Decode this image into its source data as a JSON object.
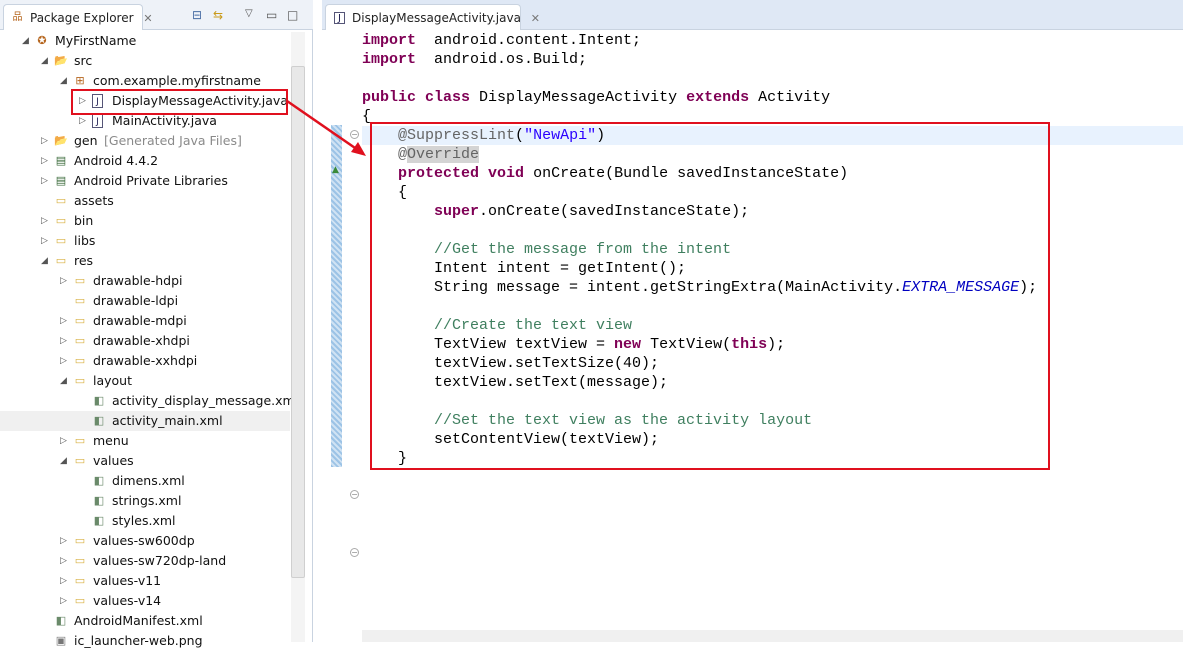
{
  "package_explorer": {
    "title": "Package Explorer",
    "icons": [
      "collapse-all-icon",
      "link-with-editor-icon",
      "view-menu-icon",
      "minimize-icon",
      "maximize-icon"
    ],
    "tree": [
      {
        "label": "MyFirstName",
        "level": 0,
        "state": "open",
        "icon": "project-icon"
      },
      {
        "label": "src",
        "level": 1,
        "state": "open",
        "icon": "source-folder-icon"
      },
      {
        "label": "com.example.myfirstname",
        "level": 2,
        "state": "open",
        "icon": "package-icon"
      },
      {
        "label": "DisplayMessageActivity.java",
        "level": 3,
        "state": "closed",
        "icon": "java-file-icon",
        "highlighted": true
      },
      {
        "label": "MainActivity.java",
        "level": 3,
        "state": "closed",
        "icon": "java-file-icon"
      },
      {
        "label": "gen",
        "suffix": "[Generated Java Files]",
        "level": 1,
        "state": "closed",
        "icon": "source-folder-icon"
      },
      {
        "label": "Android 4.4.2",
        "level": 1,
        "state": "closed",
        "icon": "library-icon"
      },
      {
        "label": "Android Private Libraries",
        "level": 1,
        "state": "closed",
        "icon": "library-icon"
      },
      {
        "label": "assets",
        "level": 1,
        "state": "none",
        "icon": "folder-icon"
      },
      {
        "label": "bin",
        "level": 1,
        "state": "closed",
        "icon": "folder-icon"
      },
      {
        "label": "libs",
        "level": 1,
        "state": "closed",
        "icon": "folder-icon"
      },
      {
        "label": "res",
        "level": 1,
        "state": "open",
        "icon": "folder-icon"
      },
      {
        "label": "drawable-hdpi",
        "level": 2,
        "state": "closed",
        "icon": "folder-icon"
      },
      {
        "label": "drawable-ldpi",
        "level": 2,
        "state": "none",
        "icon": "folder-icon"
      },
      {
        "label": "drawable-mdpi",
        "level": 2,
        "state": "closed",
        "icon": "folder-icon"
      },
      {
        "label": "drawable-xhdpi",
        "level": 2,
        "state": "closed",
        "icon": "folder-icon"
      },
      {
        "label": "drawable-xxhdpi",
        "level": 2,
        "state": "closed",
        "icon": "folder-icon"
      },
      {
        "label": "layout",
        "level": 2,
        "state": "open",
        "icon": "folder-icon"
      },
      {
        "label": "activity_display_message.xml",
        "level": 3,
        "state": "none",
        "icon": "xml-file-icon"
      },
      {
        "label": "activity_main.xml",
        "level": 3,
        "state": "none",
        "icon": "xml-file-icon",
        "selected": true
      },
      {
        "label": "menu",
        "level": 2,
        "state": "closed",
        "icon": "folder-icon"
      },
      {
        "label": "values",
        "level": 2,
        "state": "open",
        "icon": "folder-icon"
      },
      {
        "label": "dimens.xml",
        "level": 3,
        "state": "none",
        "icon": "xml-file-icon"
      },
      {
        "label": "strings.xml",
        "level": 3,
        "state": "none",
        "icon": "xml-file-icon"
      },
      {
        "label": "styles.xml",
        "level": 3,
        "state": "none",
        "icon": "xml-file-icon"
      },
      {
        "label": "values-sw600dp",
        "level": 2,
        "state": "closed",
        "icon": "folder-icon"
      },
      {
        "label": "values-sw720dp-land",
        "level": 2,
        "state": "closed",
        "icon": "folder-icon"
      },
      {
        "label": "values-v11",
        "level": 2,
        "state": "closed",
        "icon": "folder-icon"
      },
      {
        "label": "values-v14",
        "level": 2,
        "state": "closed",
        "icon": "folder-icon"
      },
      {
        "label": "AndroidManifest.xml",
        "level": 1,
        "state": "none",
        "icon": "xml-file-icon"
      },
      {
        "label": "ic_launcher-web.png",
        "level": 1,
        "state": "none",
        "icon": "image-file-icon"
      }
    ]
  },
  "editor": {
    "tab_title": "DisplayMessageActivity.java",
    "lines": [
      [
        [
          "kw",
          "import"
        ],
        [
          "",
          "  android.content.Intent;"
        ]
      ],
      [
        [
          "kw",
          "import"
        ],
        [
          "",
          "  android.os.Build;"
        ]
      ],
      [],
      [
        [
          "kw",
          "public"
        ],
        [
          "",
          " "
        ],
        [
          "kw",
          "class"
        ],
        [
          "",
          " DisplayMessageActivity "
        ],
        [
          "kw",
          "extends"
        ],
        [
          "",
          " Activity"
        ]
      ],
      [
        [
          "",
          "{"
        ]
      ],
      [
        [
          "",
          "    "
        ],
        [
          "ann",
          "@SuppressLint"
        ],
        [
          "",
          "(",
          ""
        ],
        [
          "str",
          "\"NewApi\""
        ],
        [
          "",
          ")"
        ]
      ],
      [
        [
          "",
          "    "
        ],
        [
          "ann",
          "@"
        ],
        [
          "ann hl",
          "Override"
        ]
      ],
      [
        [
          "",
          "    "
        ],
        [
          "kw",
          "protected"
        ],
        [
          "",
          " "
        ],
        [
          "kw",
          "void"
        ],
        [
          "",
          " onCreate(Bundle savedInstanceState)"
        ]
      ],
      [
        [
          "",
          "    {"
        ]
      ],
      [
        [
          "",
          "        "
        ],
        [
          "kw",
          "super"
        ],
        [
          "",
          ".onCreate(savedInstanceState);"
        ]
      ],
      [],
      [
        [
          "",
          "        "
        ],
        [
          "cm",
          "//Get the message from the intent"
        ]
      ],
      [
        [
          "",
          "        Intent intent = getIntent();"
        ]
      ],
      [
        [
          "",
          "        String message = intent.getStringExtra(MainActivity."
        ],
        [
          "it",
          "EXTRA_MESSAGE"
        ],
        [
          "",
          ");"
        ]
      ],
      [],
      [
        [
          "",
          "        "
        ],
        [
          "cm",
          "//Create the text view"
        ]
      ],
      [
        [
          "",
          "        TextView textView = "
        ],
        [
          "kw",
          "new"
        ],
        [
          "",
          " TextView("
        ],
        [
          "kw",
          "this"
        ],
        [
          "",
          ");"
        ]
      ],
      [
        [
          "",
          "        textView.setTextSize(40);"
        ]
      ],
      [
        [
          "",
          "        textView.setText(message);"
        ]
      ],
      [],
      [
        [
          "",
          "        "
        ],
        [
          "cm",
          "//Set the text view as the activity layout"
        ]
      ],
      [
        [
          "",
          "        setContentView(textView);"
        ]
      ],
      [
        [
          "",
          "    }"
        ]
      ]
    ]
  },
  "colors": {
    "annotation_red": "#e0101e",
    "keyword": "#7f0055",
    "string": "#2a00ff",
    "comment": "#3f7f5f"
  }
}
